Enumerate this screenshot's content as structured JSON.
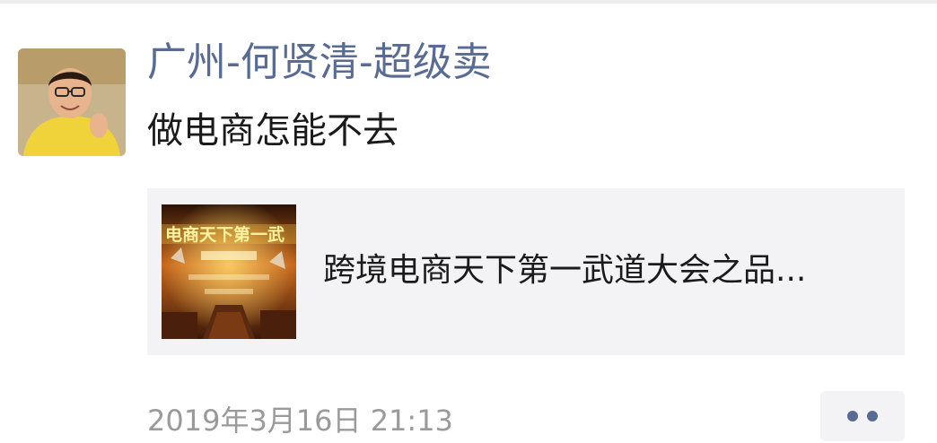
{
  "post": {
    "username": "广州-何贤清-超级卖",
    "text": "做电商怎能不去",
    "link_card": {
      "title": "跨境电商天下第一武道大会之品...",
      "thumbnail_text": "电商天下第一武"
    },
    "timestamp": "2019年3月16日 21:13"
  },
  "colors": {
    "username": "#576b95",
    "card_background": "#f3f3f5",
    "timestamp": "#9a9a9a"
  },
  "icons": {
    "more": "more-dots-icon"
  }
}
